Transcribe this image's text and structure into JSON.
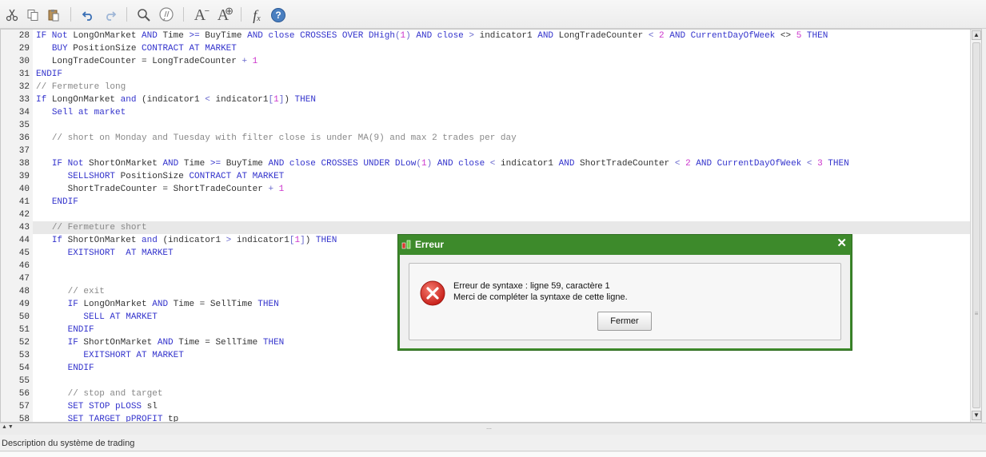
{
  "toolbar": {
    "buttons": [
      "cut",
      "copy",
      "paste",
      "undo",
      "redo",
      "search",
      "comment",
      "decrease-font",
      "increase-font",
      "function",
      "help"
    ],
    "font_small_label": "A",
    "font_large_label": "A",
    "fx_label": "f",
    "fx_sub": "x",
    "help_label": "?"
  },
  "editor": {
    "lines": [
      {
        "n": "28",
        "tokens": [
          [
            "kw",
            "IF Not "
          ],
          [
            "",
            "LongOnMarket "
          ],
          [
            "kw",
            "AND "
          ],
          [
            "",
            "Time "
          ],
          [
            "kw",
            ">= "
          ],
          [
            "",
            "BuyTime "
          ],
          [
            "kw",
            "AND close CROSSES OVER DHigh"
          ],
          [
            "op",
            "("
          ],
          [
            "num",
            "1"
          ],
          [
            "op",
            ")"
          ],
          [
            "kw",
            " AND close "
          ],
          [
            "op",
            "> "
          ],
          [
            "",
            "indicator1 "
          ],
          [
            "kw",
            "AND "
          ],
          [
            "",
            "LongTradeCounter "
          ],
          [
            "op",
            "< "
          ],
          [
            "num",
            "2 "
          ],
          [
            "kw",
            "AND CurrentDayOfWeek "
          ],
          [
            "",
            "<> "
          ],
          [
            "num",
            "5 "
          ],
          [
            "kw",
            "THEN"
          ]
        ]
      },
      {
        "n": "29",
        "tokens": [
          [
            "",
            "   "
          ],
          [
            "kw",
            "BUY "
          ],
          [
            "",
            "PositionSize "
          ],
          [
            "kw",
            "CONTRACT AT MARKET"
          ]
        ]
      },
      {
        "n": "30",
        "tokens": [
          [
            "",
            "   LongTradeCounter = LongTradeCounter "
          ],
          [
            "op",
            "+ "
          ],
          [
            "num",
            "1"
          ]
        ]
      },
      {
        "n": "31",
        "tokens": [
          [
            "kw",
            "ENDIF"
          ]
        ]
      },
      {
        "n": "32",
        "tokens": [
          [
            "cm",
            "// Fermeture long"
          ]
        ]
      },
      {
        "n": "33",
        "tokens": [
          [
            "kw",
            "If "
          ],
          [
            "",
            "LongOnMarket "
          ],
          [
            "kw",
            "and "
          ],
          [
            "",
            "(indicator1 "
          ],
          [
            "op",
            "< "
          ],
          [
            "",
            "indicator1"
          ],
          [
            "op",
            "["
          ],
          [
            "num",
            "1"
          ],
          [
            "op",
            "]"
          ],
          [
            "",
            ") "
          ],
          [
            "kw",
            "THEN"
          ]
        ]
      },
      {
        "n": "34",
        "tokens": [
          [
            "",
            "   "
          ],
          [
            "kw",
            "Sell at market"
          ]
        ]
      },
      {
        "n": "35",
        "tokens": [
          [
            "",
            ""
          ]
        ]
      },
      {
        "n": "36",
        "tokens": [
          [
            "",
            "   "
          ],
          [
            "cm",
            "// short on Monday and Tuesday with filter close is under MA(9) and max 2 trades per day"
          ]
        ]
      },
      {
        "n": "37",
        "tokens": [
          [
            "",
            ""
          ]
        ]
      },
      {
        "n": "38",
        "tokens": [
          [
            "",
            "   "
          ],
          [
            "kw",
            "IF Not "
          ],
          [
            "",
            "ShortOnMarket "
          ],
          [
            "kw",
            "AND "
          ],
          [
            "",
            "Time "
          ],
          [
            "kw",
            ">= "
          ],
          [
            "",
            "BuyTime "
          ],
          [
            "kw",
            "AND close CROSSES UNDER DLow"
          ],
          [
            "op",
            "("
          ],
          [
            "num",
            "1"
          ],
          [
            "op",
            ")"
          ],
          [
            "kw",
            " AND close "
          ],
          [
            "op",
            "< "
          ],
          [
            "",
            "indicator1 "
          ],
          [
            "kw",
            "AND "
          ],
          [
            "",
            "ShortTradeCounter "
          ],
          [
            "op",
            "< "
          ],
          [
            "num",
            "2 "
          ],
          [
            "kw",
            "AND CurrentDayOfWeek "
          ],
          [
            "op",
            "< "
          ],
          [
            "num",
            "3 "
          ],
          [
            "kw",
            "THEN"
          ]
        ]
      },
      {
        "n": "39",
        "tokens": [
          [
            "",
            "      "
          ],
          [
            "kw",
            "SELLSHORT "
          ],
          [
            "",
            "PositionSize "
          ],
          [
            "kw",
            "CONTRACT AT MARKET"
          ]
        ]
      },
      {
        "n": "40",
        "tokens": [
          [
            "",
            "      ShortTradeCounter = ShortTradeCounter "
          ],
          [
            "op",
            "+ "
          ],
          [
            "num",
            "1"
          ]
        ]
      },
      {
        "n": "41",
        "tokens": [
          [
            "",
            "   "
          ],
          [
            "kw",
            "ENDIF"
          ]
        ]
      },
      {
        "n": "42",
        "tokens": [
          [
            "",
            ""
          ]
        ]
      },
      {
        "n": "43",
        "tokens": [
          [
            "",
            "   "
          ],
          [
            "cm",
            "// Fermeture short"
          ]
        ]
      },
      {
        "n": "44",
        "tokens": [
          [
            "",
            "   "
          ],
          [
            "kw",
            "If "
          ],
          [
            "",
            "ShortOnMarket "
          ],
          [
            "kw",
            "and "
          ],
          [
            "",
            "(indicator1 "
          ],
          [
            "op",
            "> "
          ],
          [
            "",
            "indicator1"
          ],
          [
            "op",
            "["
          ],
          [
            "num",
            "1"
          ],
          [
            "op",
            "]"
          ],
          [
            "",
            ") "
          ],
          [
            "kw",
            "THEN"
          ]
        ]
      },
      {
        "n": "45",
        "tokens": [
          [
            "",
            "      "
          ],
          [
            "kw",
            "EXITSHORT  AT MARKET"
          ]
        ]
      },
      {
        "n": "46",
        "tokens": [
          [
            "",
            ""
          ]
        ]
      },
      {
        "n": "47",
        "tokens": [
          [
            "",
            ""
          ]
        ]
      },
      {
        "n": "48",
        "tokens": [
          [
            "",
            "      "
          ],
          [
            "cm",
            "// exit"
          ]
        ]
      },
      {
        "n": "49",
        "tokens": [
          [
            "",
            "      "
          ],
          [
            "kw",
            "IF "
          ],
          [
            "",
            "LongOnMarket "
          ],
          [
            "kw",
            "AND "
          ],
          [
            "",
            "Time = SellTime "
          ],
          [
            "kw",
            "THEN"
          ]
        ]
      },
      {
        "n": "50",
        "tokens": [
          [
            "",
            "         "
          ],
          [
            "kw",
            "SELL AT MARKET"
          ]
        ]
      },
      {
        "n": "51",
        "tokens": [
          [
            "",
            "      "
          ],
          [
            "kw",
            "ENDIF"
          ]
        ]
      },
      {
        "n": "52",
        "tokens": [
          [
            "",
            "      "
          ],
          [
            "kw",
            "IF "
          ],
          [
            "",
            "ShortOnMarket "
          ],
          [
            "kw",
            "AND "
          ],
          [
            "",
            "Time = SellTime "
          ],
          [
            "kw",
            "THEN"
          ]
        ]
      },
      {
        "n": "53",
        "tokens": [
          [
            "",
            "         "
          ],
          [
            "kw",
            "EXITSHORT AT MARKET"
          ]
        ]
      },
      {
        "n": "54",
        "tokens": [
          [
            "",
            "      "
          ],
          [
            "kw",
            "ENDIF"
          ]
        ]
      },
      {
        "n": "55",
        "tokens": [
          [
            "",
            ""
          ]
        ]
      },
      {
        "n": "56",
        "tokens": [
          [
            "",
            "      "
          ],
          [
            "cm",
            "// stop and target"
          ]
        ]
      },
      {
        "n": "57",
        "tokens": [
          [
            "",
            "      "
          ],
          [
            "kw",
            "SET STOP pLOSS "
          ],
          [
            "",
            "sl"
          ]
        ]
      },
      {
        "n": "58",
        "tokens": [
          [
            "",
            "      "
          ],
          [
            "kw",
            "SET TARGET pPROFIT "
          ],
          [
            "",
            "tp"
          ]
        ]
      }
    ],
    "highlighted_line": "43",
    "scroll_up": "▲",
    "scroll_down": "▼",
    "scroll_grip": "≡"
  },
  "bottom": {
    "splitter_arrows": "▲▼",
    "splitter_grip": "⋯",
    "description_label": "Description du système de trading"
  },
  "dialog": {
    "title": "Erreur",
    "close_glyph": "✕",
    "message_line1": "Erreur de syntaxe : ligne 59, caractère 1",
    "message_line2": "Merci de compléter la syntaxe de cette ligne.",
    "button_label": "Fermer",
    "accent_color": "#3d8a2b"
  }
}
